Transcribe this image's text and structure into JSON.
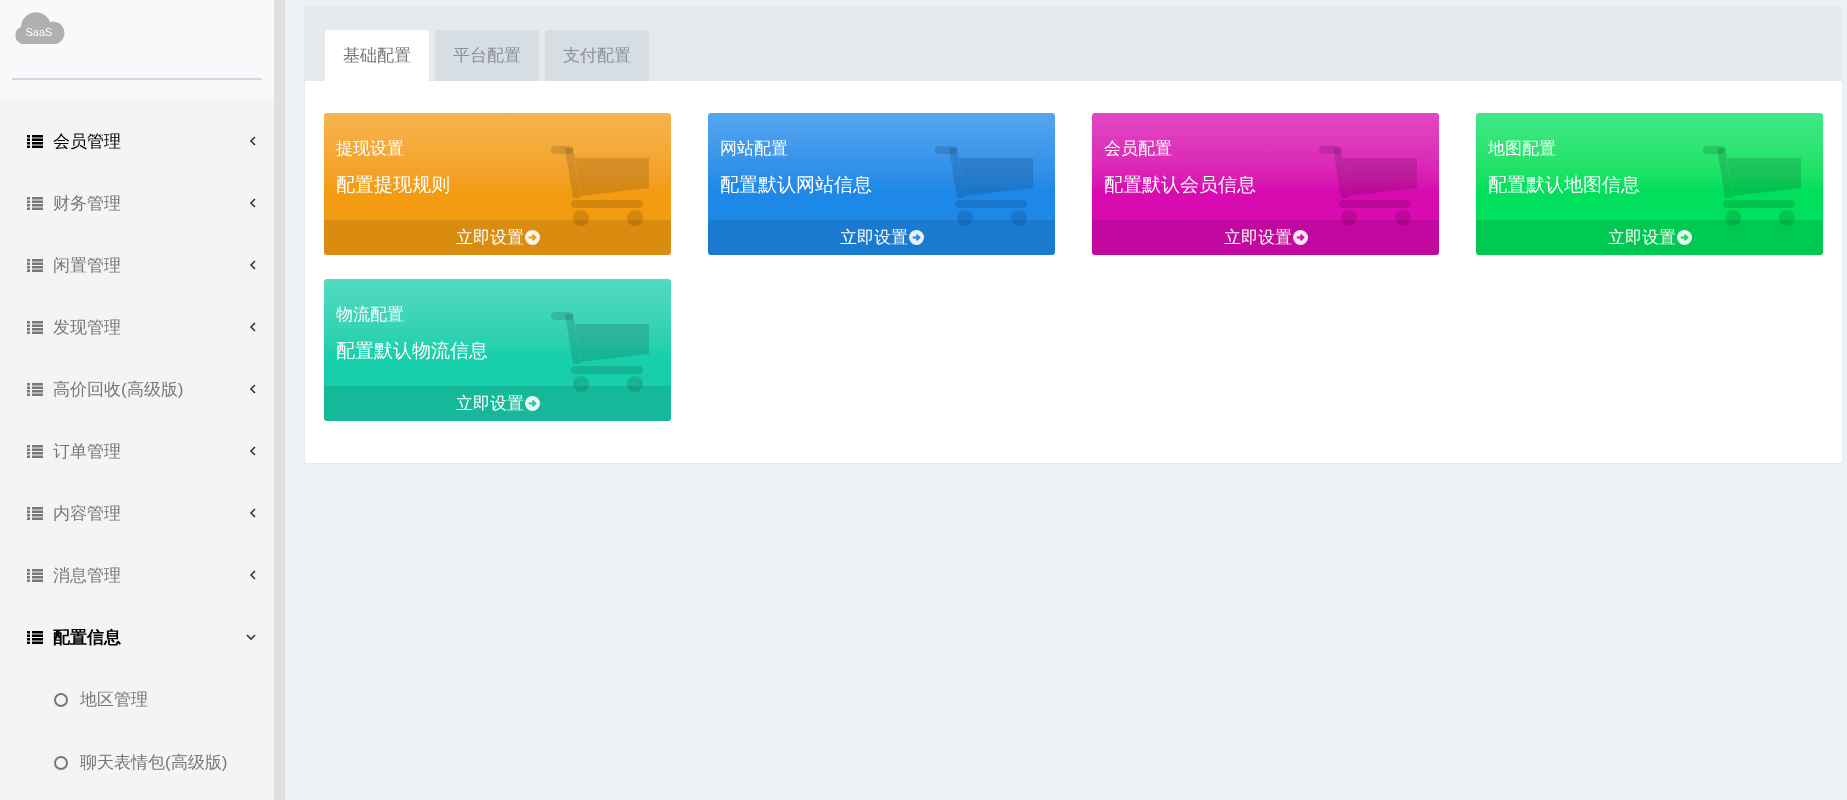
{
  "logo": {
    "text": "SaaS"
  },
  "sidebar": {
    "items": [
      {
        "label": "会员管理",
        "active": true,
        "expanded": false
      },
      {
        "label": "财务管理",
        "active": false,
        "expanded": false
      },
      {
        "label": "闲置管理",
        "active": false,
        "expanded": false
      },
      {
        "label": "发现管理",
        "active": false,
        "expanded": false
      },
      {
        "label": "高价回收(高级版)",
        "active": false,
        "expanded": false
      },
      {
        "label": "订单管理",
        "active": false,
        "expanded": false
      },
      {
        "label": "内容管理",
        "active": false,
        "expanded": false
      },
      {
        "label": "消息管理",
        "active": false,
        "expanded": false
      },
      {
        "label": "配置信息",
        "active": true,
        "expanded": true,
        "children": [
          {
            "label": "地区管理"
          },
          {
            "label": "聊天表情包(高级版)"
          }
        ]
      }
    ]
  },
  "tabs": [
    {
      "label": "基础配置",
      "selected": true
    },
    {
      "label": "平台配置",
      "selected": false
    },
    {
      "label": "支付配置",
      "selected": false
    }
  ],
  "cards": [
    {
      "title": "提现设置",
      "subtitle": "配置提现规则",
      "action": "立即设置",
      "color": "#f39c12"
    },
    {
      "title": "网站配置",
      "subtitle": "配置默认网站信息",
      "action": "立即设置",
      "color": "#1e88e8"
    },
    {
      "title": "会员配置",
      "subtitle": "配置默认会员信息",
      "action": "立即设置",
      "color": "#d80ab0"
    },
    {
      "title": "地图配置",
      "subtitle": "配置默认地图信息",
      "action": "立即设置",
      "color": "#00e05c"
    },
    {
      "title": "物流配置",
      "subtitle": "配置默认物流信息",
      "action": "立即设置",
      "color": "#18cfab"
    }
  ]
}
